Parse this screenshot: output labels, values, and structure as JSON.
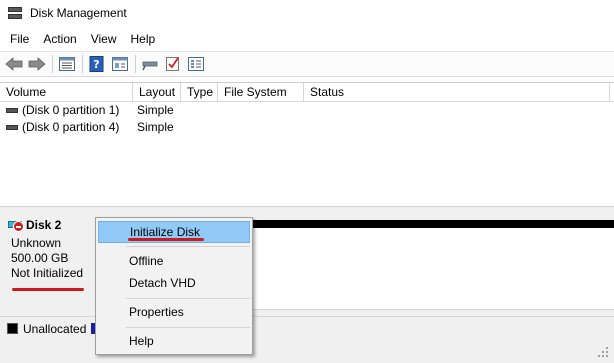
{
  "window": {
    "title": "Disk Management"
  },
  "menubar": {
    "items": [
      "File",
      "Action",
      "View",
      "Help"
    ]
  },
  "toolbar": {
    "buttons": [
      "back-arrow-icon",
      "forward-arrow-icon",
      "list-view-icon",
      "help-icon",
      "properties-view-icon",
      "key-icon",
      "checklist-icon",
      "settings-list-icon"
    ]
  },
  "volume_list": {
    "columns": [
      "Volume",
      "Layout",
      "Type",
      "File System",
      "Status"
    ],
    "rows": [
      {
        "volume": "(Disk 0 partition 1)",
        "layout": "Simple",
        "type": "",
        "file_system": "",
        "status": ""
      },
      {
        "volume": "(Disk 0 partition 4)",
        "layout": "Simple",
        "type": "",
        "file_system": "",
        "status": ""
      }
    ]
  },
  "disk": {
    "name": "Disk 2",
    "type": "Unknown",
    "size": "500.00 GB",
    "state": "Not Initialized",
    "bar_color": "#000000"
  },
  "legend": {
    "unallocated_label": "Unallocated",
    "unallocated_color": "#000000",
    "primary_color": "#1b1ea6"
  },
  "context_menu": {
    "items": [
      {
        "label": "Initialize Disk",
        "highlighted": true
      },
      {
        "label": "Offline"
      },
      {
        "label": "Detach VHD"
      },
      {
        "label": "Properties"
      },
      {
        "label": "Help"
      }
    ],
    "highlight_color": "#91c9f7"
  },
  "annotations": {
    "underline_color": "#d0191f"
  }
}
